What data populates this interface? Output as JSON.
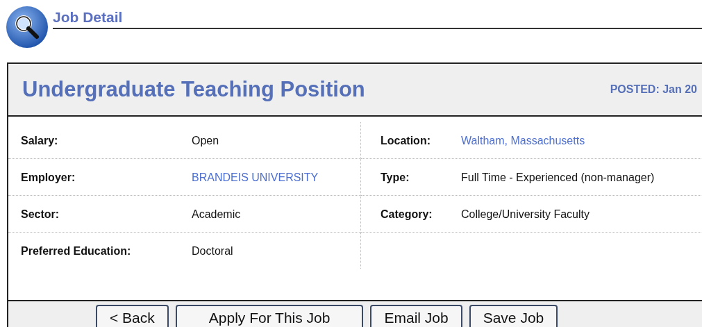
{
  "header": {
    "title": "Job Detail"
  },
  "job": {
    "title": "Undergraduate Teaching Position",
    "posted": "POSTED: Jan 20"
  },
  "rows": [
    {
      "left": {
        "label": "Salary:",
        "value": "Open",
        "kind": "text"
      },
      "right": {
        "label": "Location:",
        "value": "Waltham, Massachusetts",
        "kind": "link"
      }
    },
    {
      "left": {
        "label": "Employer:",
        "value": "BRANDEIS UNIVERSITY",
        "kind": "link"
      },
      "right": {
        "label": "Type:",
        "value": "Full Time - Experienced (non-manager)",
        "kind": "text"
      }
    },
    {
      "left": {
        "label": "Sector:",
        "value": "Academic",
        "kind": "text"
      },
      "right": {
        "label": "Category:",
        "value": "College/University Faculty",
        "kind": "text"
      }
    },
    {
      "left": {
        "label": "Preferred Education:",
        "value": "Doctoral",
        "kind": "text"
      }
    }
  ],
  "buttons": [
    "< Back",
    "Apply For This Job",
    "Email Job",
    "Save Job"
  ]
}
